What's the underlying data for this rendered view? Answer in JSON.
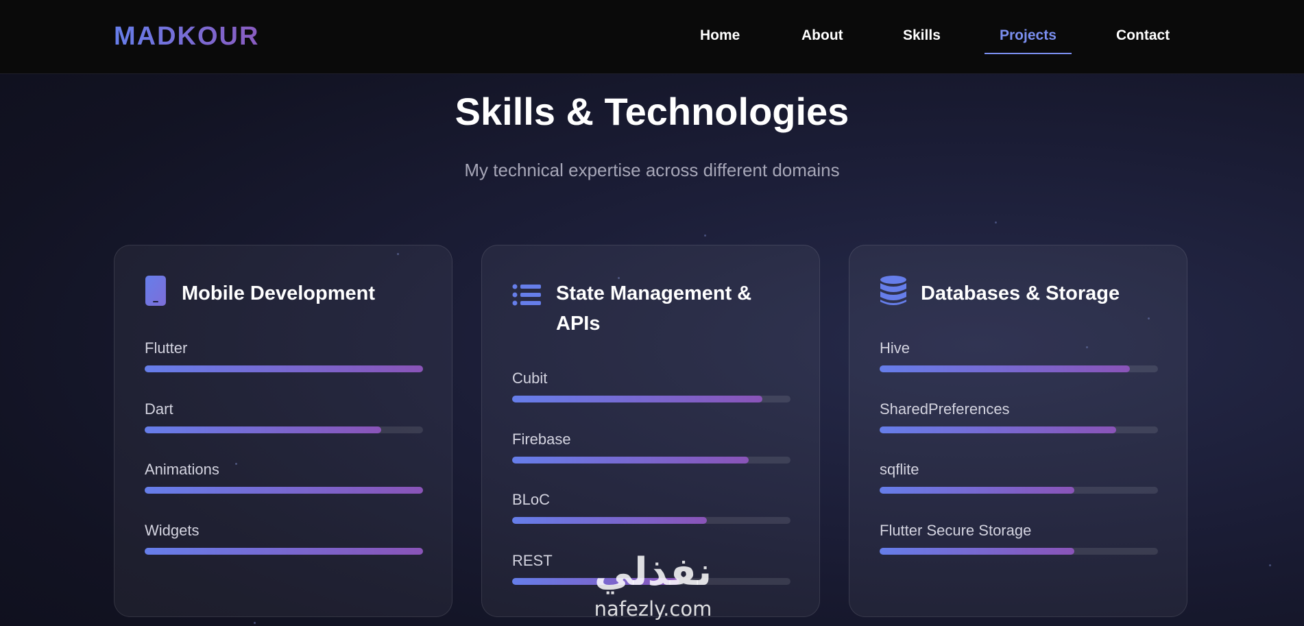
{
  "header": {
    "logo": "MADKOUR",
    "nav": [
      {
        "label": "Home",
        "active": false
      },
      {
        "label": "About",
        "active": false
      },
      {
        "label": "Skills",
        "active": false
      },
      {
        "label": "Projects",
        "active": true
      },
      {
        "label": "Contact",
        "active": false
      }
    ]
  },
  "section": {
    "title": "Skills & Technologies",
    "subtitle": "My technical expertise across different domains"
  },
  "cards": [
    {
      "title": "Mobile Development",
      "icon": "mobile-phone-icon",
      "skills": [
        {
          "name": "Flutter",
          "level": 1.0
        },
        {
          "name": "Dart",
          "level": 0.85
        },
        {
          "name": "Animations",
          "level": 1.0
        },
        {
          "name": "Widgets",
          "level": 1.0
        }
      ]
    },
    {
      "title": "State Management & APIs",
      "icon": "list-icon",
      "skills": [
        {
          "name": "Cubit",
          "level": 0.9
        },
        {
          "name": "Firebase",
          "level": 0.85
        },
        {
          "name": "BLoC",
          "level": 0.7
        },
        {
          "name": "REST",
          "level": 0.6
        }
      ]
    },
    {
      "title": "Databases & Storage",
      "icon": "database-icon",
      "skills": [
        {
          "name": "Hive",
          "level": 0.9
        },
        {
          "name": "SharedPreferences",
          "level": 0.85
        },
        {
          "name": "sqflite",
          "level": 0.7
        },
        {
          "name": "Flutter Secure Storage",
          "level": 0.7
        }
      ]
    }
  ],
  "watermark": {
    "arabic": "نفذلي",
    "latin": "nafezly.com"
  },
  "colors": {
    "accent": "#667eea",
    "accent_end": "#8a54b8",
    "nav_bg": "#0a0a0a",
    "bg": "#1b1d36"
  }
}
